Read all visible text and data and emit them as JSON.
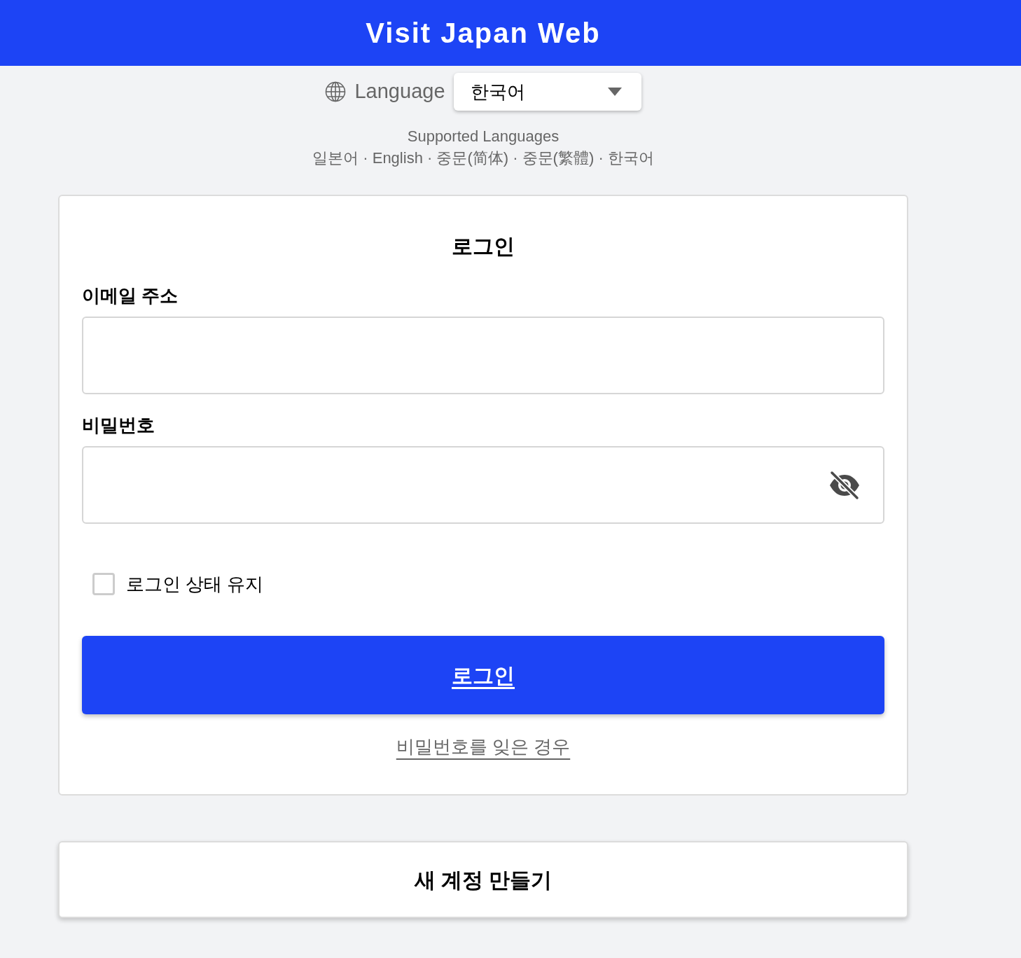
{
  "header": {
    "title": "Visit Japan Web"
  },
  "language": {
    "label": "Language",
    "value": "한국어"
  },
  "supported": {
    "title": "Supported Languages",
    "list": "일본어 · English · 중문(简体) · 중문(繁體) · 한국어"
  },
  "login": {
    "title": "로그인",
    "fields": [
      {
        "label": "이메일 주소",
        "kind": "text"
      },
      {
        "label": "비밀번호",
        "kind": "password"
      }
    ],
    "remember": {
      "label": "로그인 상태 유지",
      "checked": false
    },
    "submit": "로그인",
    "forgot": "비밀번호를 잊은 경우"
  },
  "create_account": {
    "label": "새 계정 만들기"
  }
}
